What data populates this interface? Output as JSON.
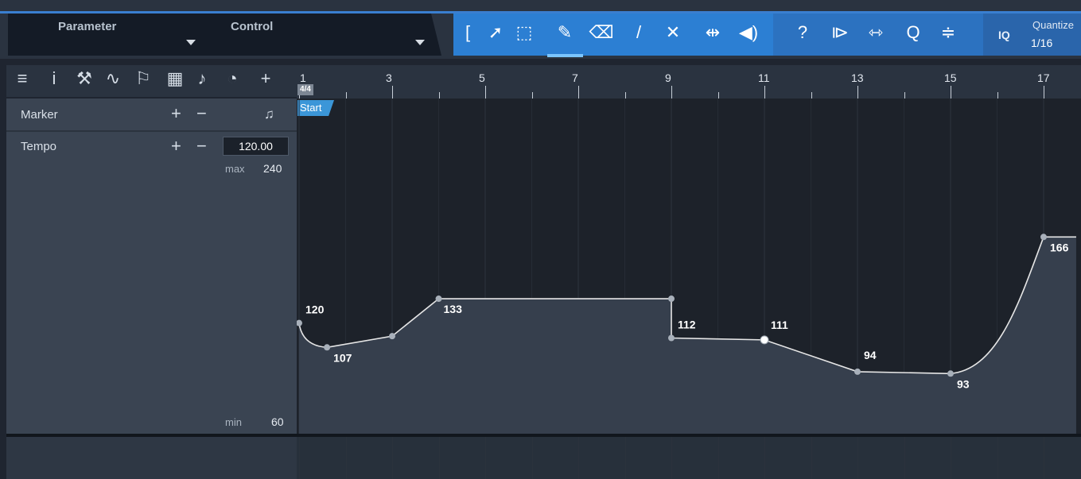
{
  "header": {
    "parameter_label": "Parameter",
    "control_label": "Control",
    "quantize_label": "Quantize",
    "quantize_value": "1/16",
    "iq_label": "IQ"
  },
  "tools": [
    {
      "name": "range-bracket-icon",
      "glyph": "["
    },
    {
      "name": "arrow-tool-icon",
      "glyph": "➚"
    },
    {
      "name": "range-select-tool-icon",
      "glyph": "⬚"
    },
    {
      "name": "pencil-tool-icon",
      "glyph": "✎"
    },
    {
      "name": "eraser-tool-icon",
      "glyph": "⌫"
    },
    {
      "name": "paint-tool-icon",
      "glyph": "/"
    },
    {
      "name": "mute-tool-icon",
      "glyph": "✕"
    },
    {
      "name": "split-tool-icon",
      "glyph": "⇹"
    },
    {
      "name": "listen-tool-icon",
      "glyph": "◀)"
    },
    {
      "name": "help-icon",
      "glyph": "?"
    },
    {
      "name": "snap-to-event-icon",
      "glyph": "⧐"
    },
    {
      "name": "timestretch-icon",
      "glyph": "⇿"
    },
    {
      "name": "quantize-icon",
      "glyph": "Q"
    },
    {
      "name": "follow-grid-icon",
      "glyph": "≑"
    }
  ],
  "left_toolbar": [
    {
      "name": "list-icon",
      "glyph": "≡"
    },
    {
      "name": "info-icon",
      "glyph": "i"
    },
    {
      "name": "wrench-icon",
      "glyph": "⚒"
    },
    {
      "name": "automation-icon",
      "glyph": "∿"
    },
    {
      "name": "flag-icon",
      "glyph": "⚐"
    },
    {
      "name": "chord-icon",
      "glyph": "▦"
    },
    {
      "name": "arranger-icon",
      "glyph": "♪"
    },
    {
      "name": "tempo-icon",
      "glyph": "◔"
    },
    {
      "name": "add-track-icon",
      "glyph": "+"
    }
  ],
  "tracks": {
    "marker_label": "Marker",
    "tempo_label": "Tempo",
    "tempo_value": "120.00",
    "max_label": "max",
    "max_value": "240",
    "min_label": "min",
    "min_value": "60",
    "plus": "+",
    "minus": "−",
    "note_glyph": "♫"
  },
  "ruler": {
    "bars": [
      "1",
      "3",
      "5",
      "7",
      "9",
      "11",
      "13",
      "15",
      "17"
    ],
    "time_signature": "4/4"
  },
  "marker": {
    "start_label": "Start"
  },
  "chart_data": {
    "type": "line",
    "series": [
      {
        "name": "Tempo",
        "points": [
          [
            1,
            120
          ],
          [
            1.6,
            107
          ],
          [
            3,
            113
          ],
          [
            4,
            133
          ],
          [
            9,
            133
          ],
          [
            9,
            112
          ],
          [
            11,
            111
          ],
          [
            13,
            94
          ],
          [
            15,
            93
          ],
          [
            17,
            166
          ],
          [
            17.7,
            166
          ]
        ]
      }
    ],
    "point_labels": [
      {
        "x": 1,
        "y": 120,
        "text": "120"
      },
      {
        "x": 1.6,
        "y": 107,
        "text": "107"
      },
      {
        "x": 4,
        "y": 133,
        "text": "133"
      },
      {
        "x": 9,
        "y": 112,
        "text": "112"
      },
      {
        "x": 11,
        "y": 111,
        "text": "111"
      },
      {
        "x": 13,
        "y": 94,
        "text": "94"
      },
      {
        "x": 15,
        "y": 93,
        "text": "93"
      },
      {
        "x": 17,
        "y": 166,
        "text": "166"
      }
    ],
    "ylim": [
      60,
      240
    ],
    "xlim": [
      1,
      18
    ],
    "colors": {
      "line": "#e6e6e6",
      "fill": "#363f4d",
      "point": "#a8b0ba"
    }
  }
}
